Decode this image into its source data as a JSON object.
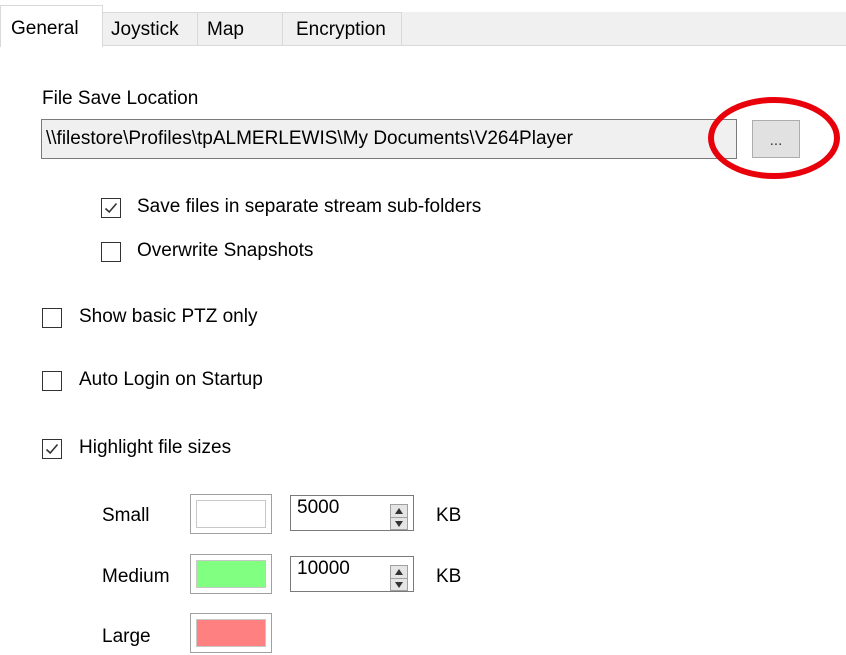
{
  "tabs": [
    {
      "label": "General",
      "active": true
    },
    {
      "label": "Joystick",
      "active": false
    },
    {
      "label": "Map",
      "active": false
    },
    {
      "label": "Encryption",
      "active": false
    }
  ],
  "file_save": {
    "label": "File Save Location",
    "path": "\\\\filestore\\Profiles\\tpALMERLEWIS\\My Documents\\V264Player",
    "browse_label": "..."
  },
  "options": {
    "separate_folders": {
      "label": "Save files in separate stream sub-folders",
      "checked": true
    },
    "overwrite_snapshots": {
      "label": "Overwrite Snapshots",
      "checked": false
    },
    "basic_ptz": {
      "label": "Show basic PTZ only",
      "checked": false
    },
    "auto_login": {
      "label": "Auto Login on Startup",
      "checked": false
    },
    "highlight_sizes": {
      "label": "Highlight file sizes",
      "checked": true
    }
  },
  "sizes": {
    "small": {
      "label": "Small",
      "color": "#ffffff",
      "value": "5000",
      "unit": "KB"
    },
    "medium": {
      "label": "Medium",
      "color": "#80ff80",
      "value": "10000",
      "unit": "KB"
    },
    "large": {
      "label": "Large",
      "color": "#ff8080"
    }
  },
  "colors": {
    "highlight_circle": "#e8000b"
  }
}
